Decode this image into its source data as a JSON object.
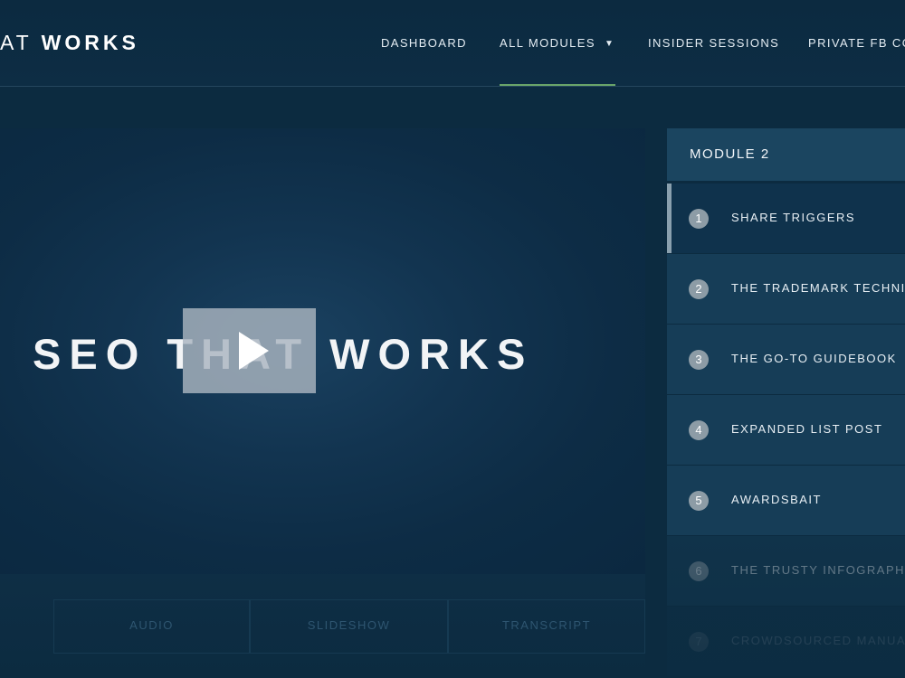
{
  "header": {
    "logo_light": "AT ",
    "logo_bold": "WORKS",
    "nav": {
      "dashboard": "DASHBOARD",
      "all_modules": "ALL MODULES",
      "insider_sessions": "INSIDER SESSIONS",
      "private_fb": "PRIVATE FB CO"
    }
  },
  "video": {
    "title": "SEO THAT WORKS"
  },
  "tabs": [
    "AUDIO",
    "SLIDESHOW",
    "TRANSCRIPT"
  ],
  "module": {
    "title": "MODULE 2",
    "lessons": [
      {
        "num": "1",
        "label": "SHARE TRIGGERS"
      },
      {
        "num": "2",
        "label": "THE TRADEMARK TECHNI"
      },
      {
        "num": "3",
        "label": "THE GO-TO GUIDEBOOK"
      },
      {
        "num": "4",
        "label": "EXPANDED LIST POST"
      },
      {
        "num": "5",
        "label": "AWARDSBAIT"
      },
      {
        "num": "6",
        "label": "THE TRUSTY INFOGRAPHI"
      },
      {
        "num": "7",
        "label": "CROWDSOURCED MANUA"
      }
    ]
  },
  "colors": {
    "background": "#0c2b40",
    "accent_underline": "#6aa56a",
    "panel": "#163d57"
  }
}
